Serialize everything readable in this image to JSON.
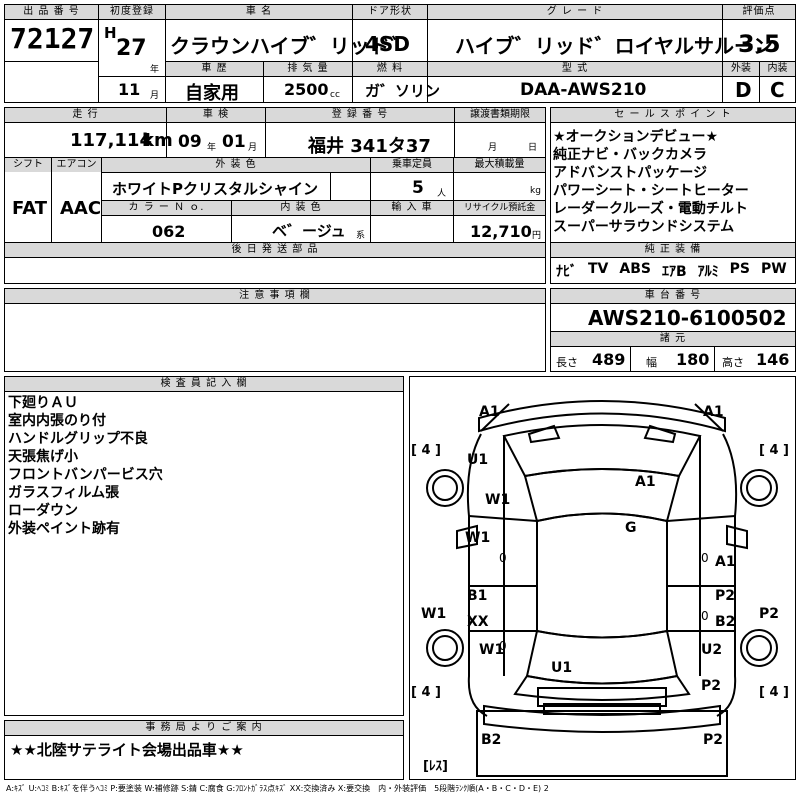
{
  "header": {
    "lot_no_label": "出 品 番 号",
    "lot_no": "72127",
    "first_reg_label": "初度登録",
    "era": "H",
    "year": "27",
    "year_unit": "年",
    "month": "11",
    "month_unit": "月",
    "car_name_label": "車 名",
    "car_name": "クラウンハイブ゛リッド゛",
    "history_label": "車 歴",
    "history": "自家用",
    "displacement_label": "排 気 量",
    "displacement": "2500",
    "displacement_unit": "cc",
    "door_label": "ドア形状",
    "door": "4SD",
    "fuel_label": "燃 料",
    "fuel": "ガ゛ソリン",
    "grade_label": "グ レ ー ド",
    "grade": "ハイブ゛リッド゛ロイヤルサルーン",
    "model_label": "型 式",
    "model": "DAA-AWS210",
    "score_label": "評価点",
    "score": "3.5",
    "exterior_label": "外装",
    "interior_label": "内装",
    "exterior": "D",
    "interior": "C"
  },
  "row2": {
    "mileage_label": "走 行",
    "mileage": "117,114",
    "mileage_unit": "km",
    "inspection_label": "車 検",
    "insp_year": "09",
    "insp_year_unit": "年",
    "insp_month": "01",
    "insp_month_unit": "月",
    "plate_label": "登 録 番 号",
    "plate": "福井 341タ37",
    "transfer_label": "譲渡書類期限",
    "transfer_month_unit": "月",
    "transfer_day_unit": "日",
    "shift_label": "シフト",
    "shift": "FAT",
    "ac_label": "エアコン",
    "ac": "AAC",
    "ext_color_label": "外 装 色",
    "ext_color": "ホワイトPクリスタルシャイン",
    "capacity_label": "乗車定員",
    "capacity": "5",
    "capacity_unit": "人",
    "max_load_label": "最大積載量",
    "max_load_unit": "kg",
    "color_no_label": "カ ラ ー Ｎ ｏ.",
    "color_no": "062",
    "int_color_label": "内 装 色",
    "int_color": "ベ゛ージュ",
    "int_color_suffix": "系",
    "import_label": "輸 入 車",
    "recycle_label": "リサイクル預託金",
    "recycle": "12,710",
    "recycle_unit": "円",
    "later_parts_label": "後 日 発 送 部 品"
  },
  "sales_points": {
    "label": "セ ー ル ス ポ イ ン ト",
    "items": [
      "★オークションデビュー★",
      "純正ナビ・バックカメラ",
      "アドバンストパッケージ",
      "パワーシート・シートヒーター",
      "レーダークルーズ・電動チルト",
      "スーパーサラウンドシステム"
    ]
  },
  "equipment": {
    "label": "純 正 装 備",
    "items": [
      "ﾅﾋﾞ",
      "TV",
      "ABS",
      "ｴｱB",
      "ｱﾙﾐ",
      "PS",
      "PW"
    ]
  },
  "notes": {
    "label": "注 意 事 項 欄"
  },
  "chassis": {
    "label": "車 台 番 号",
    "number": "AWS210-6100502",
    "dims_label": "諸 元",
    "length_label": "長さ",
    "length": "489",
    "width_label": "幅",
    "width": "180",
    "height_label": "高さ",
    "height": "146"
  },
  "inspector": {
    "label": "検 査 員 記 入 欄",
    "lines": [
      "下廻りＡＵ",
      "室内内張のり付",
      "ハンドルグリップ不良",
      "天張焦げ小",
      "フロントバンパービス穴",
      "ガラスフィルム張",
      "ローダウン",
      "外装ペイント跡有"
    ]
  },
  "office": {
    "label": "事 務 局 よ り ご 案 内",
    "message": "★★北陸サテライト会場出品車★★"
  },
  "diagram": {
    "marks": {
      "a1_fl": "A1",
      "a1_fr": "A1",
      "u1_l": "U1",
      "w1_a": "W1",
      "a1_hood": "A1",
      "g": "G",
      "w1_b": "W1",
      "a1_r": "A1",
      "b1": "B1",
      "xx": "XX",
      "p2_r": "P2",
      "b2_r": "B2",
      "w1_left": "W1",
      "p2_right": "P2",
      "w1_c": "W1",
      "u1_roof": "U1",
      "u2": "U2",
      "p2_b": "P2",
      "b2_rear": "B2",
      "p2_rear": "P2",
      "zero1": "0",
      "zero2": "0",
      "zero3": "0",
      "zero4": "0"
    },
    "tire_labels": [
      "[ 4 ]",
      "[ 4 ]",
      "[ 4 ]",
      "[ 4 ]"
    ],
    "spare_label": "[ﾚｽ]"
  },
  "legend": "A:ｷｽﾞ U:ﾍｺﾐ B:ｷｽﾞを伴うﾍｺﾐ P:要塗装 W:補修跡 S:錆 C:腐食 G:ﾌﾛﾝﾄｶﾞﾗｽ点ｷｽﾞ XX:交換済み X:要交換　内・外装評価　5段階ﾗﾝｸ順(A・B・C・D・E) 2"
}
